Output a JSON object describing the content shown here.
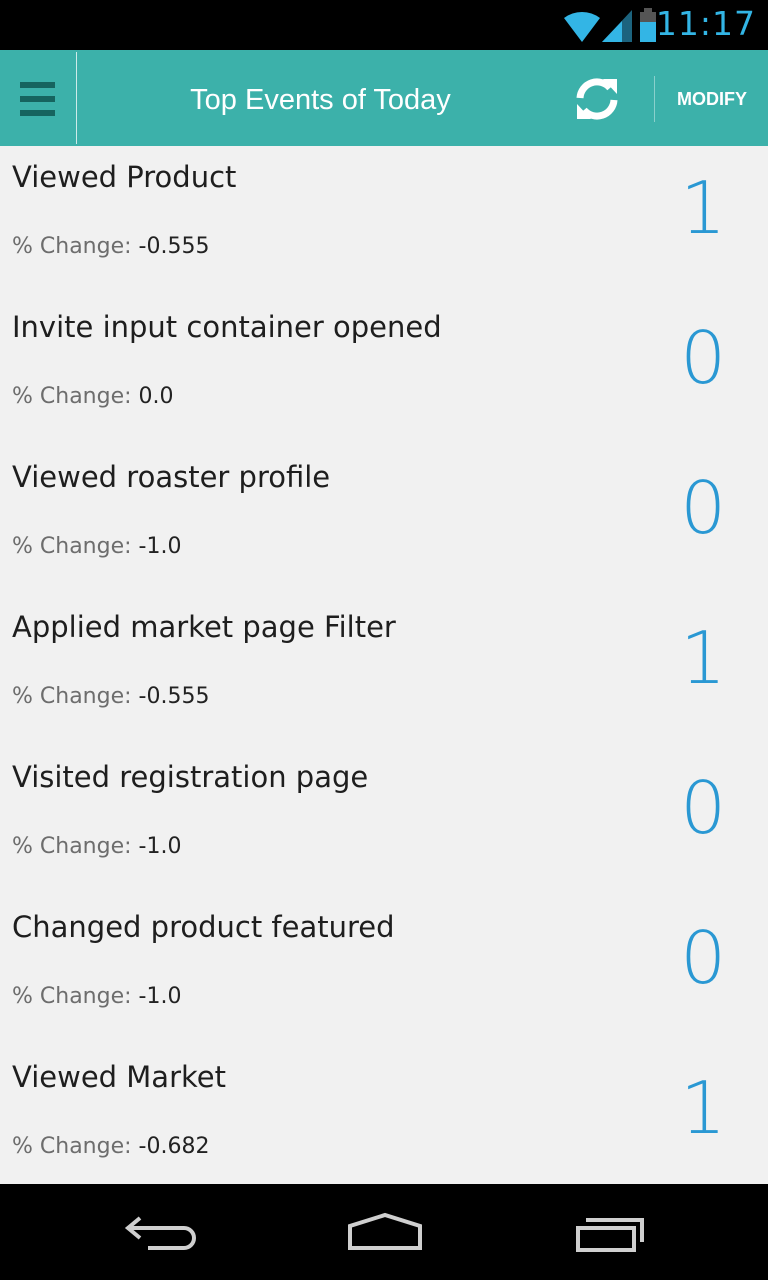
{
  "status_bar": {
    "time": "11:17",
    "icons": [
      "wifi-icon",
      "signal-icon",
      "battery-icon"
    ],
    "accent": "#33b5e5"
  },
  "action_bar": {
    "title": "Top Events of Today",
    "modify_label": "MODIFY",
    "background": "#3cb1aa"
  },
  "events": [
    {
      "name": "Viewed Product",
      "change_label": "% Change:",
      "change_value": "-0.555",
      "count": "1"
    },
    {
      "name": "Invite input container opened",
      "change_label": "% Change:",
      "change_value": "0.0",
      "count": "0"
    },
    {
      "name": "Viewed roaster profile",
      "change_label": "% Change:",
      "change_value": "-1.0",
      "count": "0"
    },
    {
      "name": "Applied market page Filter",
      "change_label": "% Change:",
      "change_value": "-0.555",
      "count": "1"
    },
    {
      "name": "Visited registration page",
      "change_label": "% Change:",
      "change_value": "-1.0",
      "count": "0"
    },
    {
      "name": "Changed product featured",
      "change_label": "% Change:",
      "change_value": "-1.0",
      "count": "0"
    },
    {
      "name": "Viewed Market",
      "change_label": "% Change:",
      "change_value": "-0.682",
      "count": "1"
    }
  ],
  "nav_bar": {
    "icons": [
      "back-icon",
      "home-icon",
      "recents-icon"
    ]
  }
}
